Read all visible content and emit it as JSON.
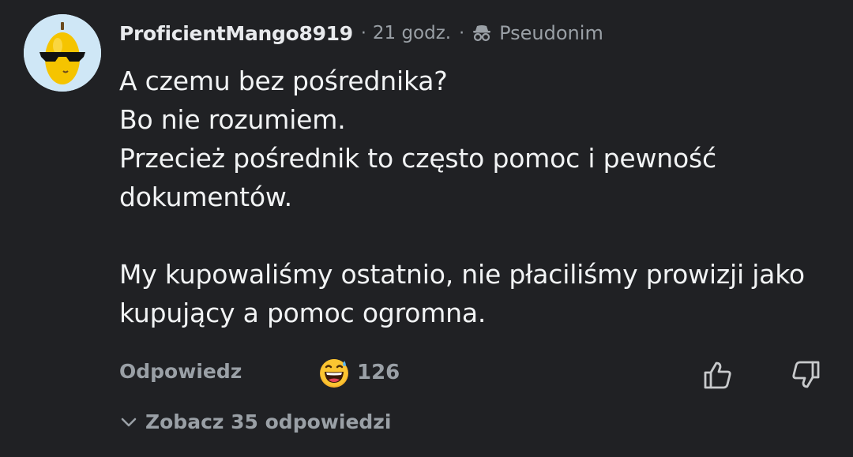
{
  "comment": {
    "author": "ProficientMango8919",
    "separator": "·",
    "time": "21 godz.",
    "badge_icon": "incognito-icon",
    "badge_label": "Pseudonim",
    "body": {
      "lines": [
        "A czemu bez pośrednika?",
        "Bo nie rozumiem.",
        "Przecież pośrednik to często pomoc i pewność dokumentów.",
        "",
        "My kupowaliśmy ostatnio, nie płaciliśmy prowizji jako kupujący a pomoc ogromna."
      ]
    },
    "actions": {
      "reply_label": "Odpowiedz",
      "reaction_icon": "grinning-sweat-emoji",
      "reaction_count": "126",
      "like_icon": "thumbs-up-icon",
      "dislike_icon": "thumbs-down-icon"
    },
    "replies": {
      "icon": "chevron-down-icon",
      "label": "Zobacz 35 odpowiedzi"
    }
  },
  "colors": {
    "background": "#202124",
    "text_primary": "#f1f3f4",
    "text_secondary": "#9aa0a6",
    "avatar_bg": "#cfe7f6",
    "mango": "#f5c400"
  }
}
